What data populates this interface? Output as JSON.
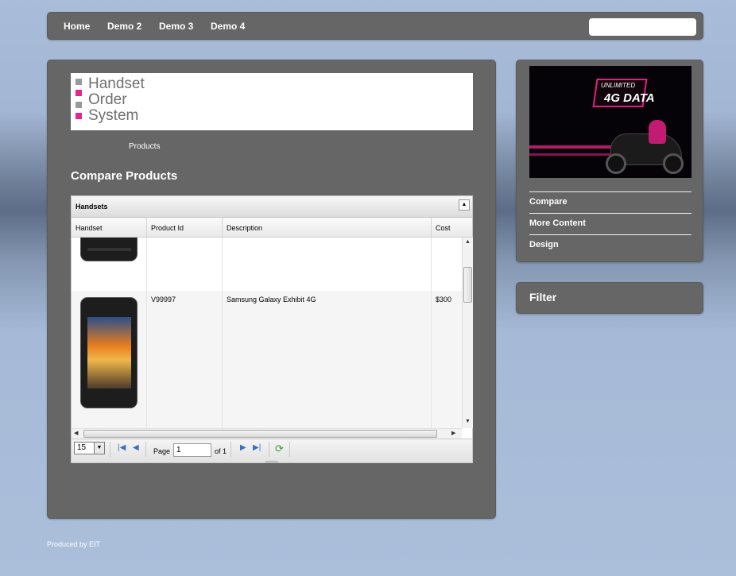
{
  "nav": {
    "items": [
      "Home",
      "Demo 2",
      "Demo 3",
      "Demo 4"
    ],
    "search_value": ""
  },
  "logo": {
    "lines": [
      "Handset",
      "Order",
      "System"
    ],
    "square_colors": [
      "#9a9a9a",
      "#e8258f",
      "#9a9a9a",
      "#e8258f"
    ]
  },
  "breadcrumb": "Products",
  "page_title": "Compare Products",
  "grid": {
    "caption": "Handsets",
    "columns": [
      "Handset",
      "Product Id",
      "Description",
      "Cost"
    ],
    "rows": [
      {
        "product_id": "",
        "description": "",
        "cost": ""
      },
      {
        "product_id": "V99997",
        "description": "Samsung Galaxy Exhibit 4G",
        "cost": "$300"
      }
    ],
    "pager": {
      "page_size": "15",
      "page_label": "Page",
      "page_value": "1",
      "of_label": "of 1"
    }
  },
  "sidebar": {
    "promo": {
      "line1": "UNLIMITED",
      "line2": "4G DATA"
    },
    "links": [
      "Compare",
      "More Content",
      "Design"
    ]
  },
  "filter": {
    "title": "Filter"
  },
  "footer": "Produced by EIT",
  "colors": {
    "panel": "#666666",
    "accent": "#e8258f"
  }
}
